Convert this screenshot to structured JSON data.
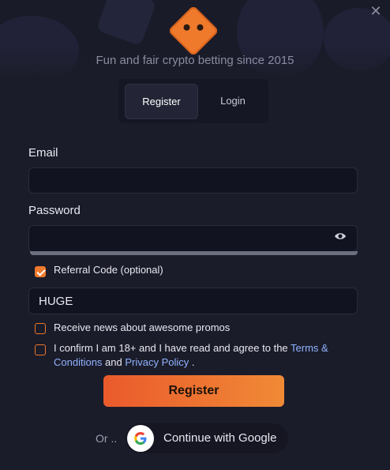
{
  "header": {
    "tagline": "Fun and fair crypto betting since 2015",
    "close_icon": "close-icon",
    "logo": "dice-logo"
  },
  "tabs": [
    {
      "label": "Register",
      "active": true
    },
    {
      "label": "Login",
      "active": false
    }
  ],
  "form": {
    "email_label": "Email",
    "email_value": "",
    "password_label": "Password",
    "password_value": "",
    "referral_label": "Referral Code (optional)",
    "referral_checked": true,
    "referral_value": "HUGE",
    "promos_label": "Receive news about awesome promos",
    "promos_checked": false,
    "confirm_prefix": "I confirm I am 18+ and I have read and agree to the ",
    "terms_link": "Terms & Conditions",
    "confirm_and": " and ",
    "privacy_link": "Privacy Policy",
    "confirm_suffix": " .",
    "confirm_checked": false
  },
  "actions": {
    "register_label": "Register",
    "or_text": "Or ..",
    "google_label": "Continue with Google"
  },
  "colors": {
    "accent": "#f07a2b",
    "background": "#1b1c2a",
    "link": "#8fb3ff"
  }
}
